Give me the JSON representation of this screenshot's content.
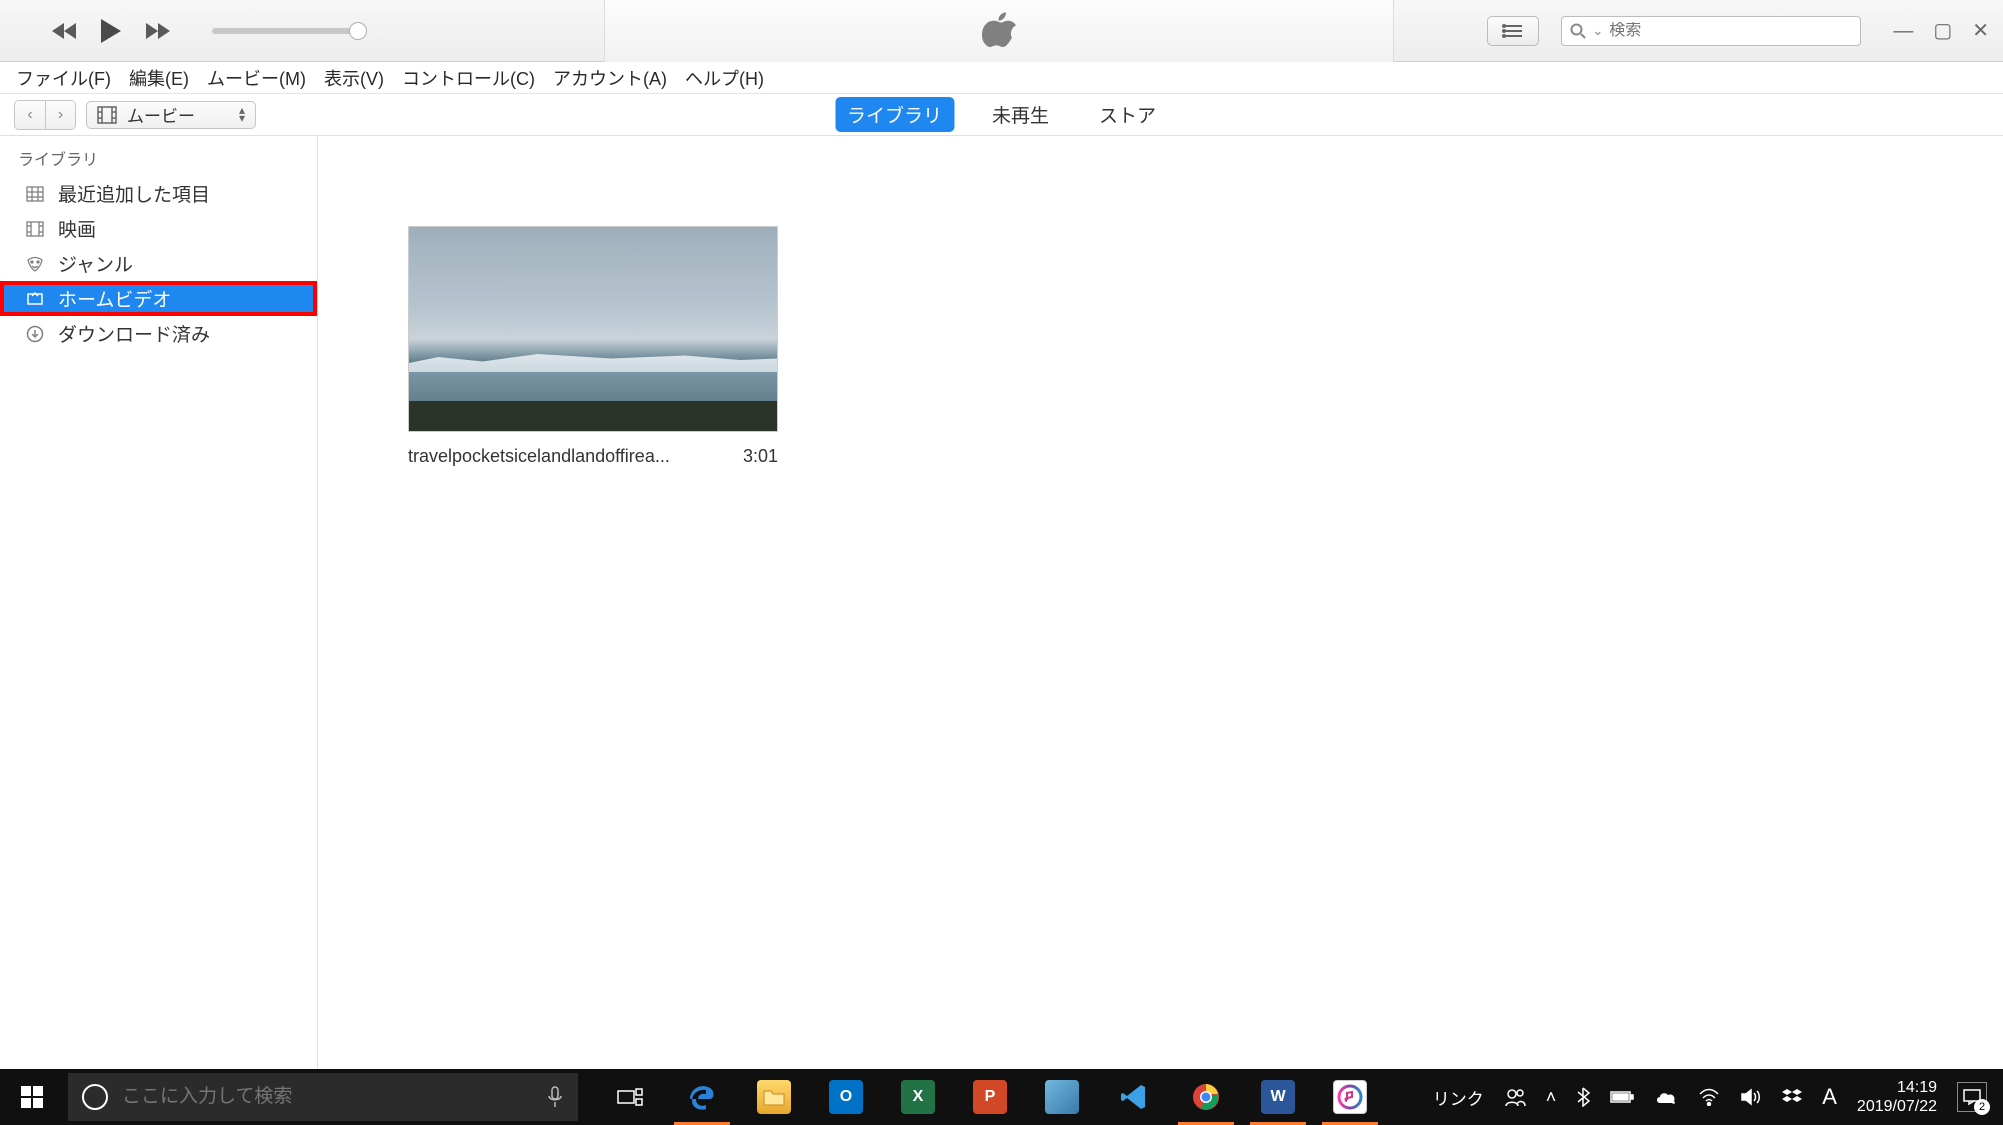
{
  "app": {
    "menubar": [
      "ファイル(F)",
      "編集(E)",
      "ムービー(M)",
      "表示(V)",
      "コントロール(C)",
      "アカウント(A)",
      "ヘルプ(H)"
    ],
    "search_placeholder": "検索",
    "media_selector_label": "ムービー",
    "tabs": {
      "library": "ライブラリ",
      "unplayed": "未再生",
      "store": "ストア"
    }
  },
  "sidebar": {
    "header": "ライブラリ",
    "items": [
      {
        "label": "最近追加した項目",
        "icon": "grid-icon"
      },
      {
        "label": "映画",
        "icon": "film-icon"
      },
      {
        "label": "ジャンル",
        "icon": "genre-icon"
      },
      {
        "label": "ホームビデオ",
        "icon": "home-video-icon",
        "selected": true,
        "highlighted": true
      },
      {
        "label": "ダウンロード済み",
        "icon": "download-icon"
      }
    ]
  },
  "content": {
    "videos": [
      {
        "title": "travelpocketsicelandlandoffirea...",
        "duration": "3:01"
      }
    ]
  },
  "taskbar": {
    "cortana_placeholder": "ここに入力して検索",
    "link_label": "リンク",
    "clock_time": "14:19",
    "clock_date": "2019/07/22",
    "ime_indicator": "A",
    "notification_count": "2"
  }
}
